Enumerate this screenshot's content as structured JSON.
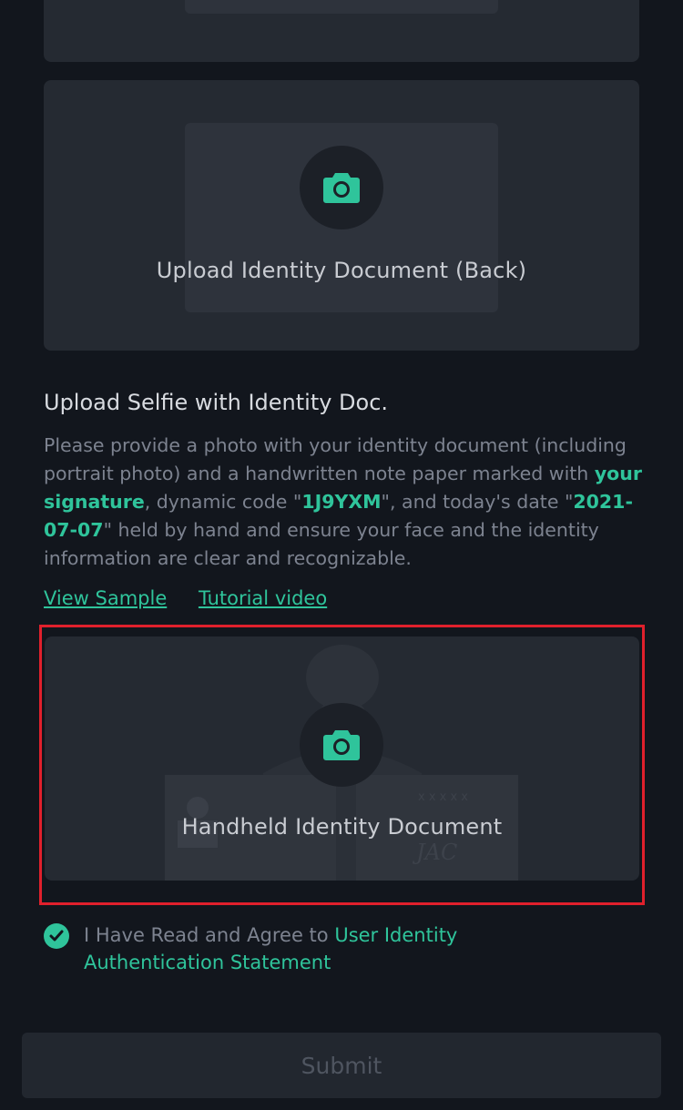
{
  "upload_back": {
    "label": "Upload Identity Document (Back)"
  },
  "selfie_section": {
    "title": "Upload Selfie with Identity Doc.",
    "desc_1": "Please provide a photo with your identity document (including portrait photo) and a handwritten note paper marked with ",
    "desc_signature": "your signature",
    "desc_2": ", dynamic code \"",
    "desc_code": "1J9YXM",
    "desc_3": "\", and today's date \"",
    "desc_date": "2021-07-07",
    "desc_4": "\" held by hand and ensure your face and the identity information are clear and recognizable."
  },
  "links": {
    "view_sample": "View Sample",
    "tutorial_video": "Tutorial video"
  },
  "handheld": {
    "label": "Handheld Identity Document"
  },
  "agreement": {
    "text": "I Have Read and Agree to ",
    "link": "User Identity Authentication Statement",
    "checked": true
  },
  "submit": {
    "label": "Submit"
  },
  "colors": {
    "accent": "#2fc49b",
    "background": "#12161d",
    "card": "#252a32",
    "highlight": "#e0202c"
  }
}
